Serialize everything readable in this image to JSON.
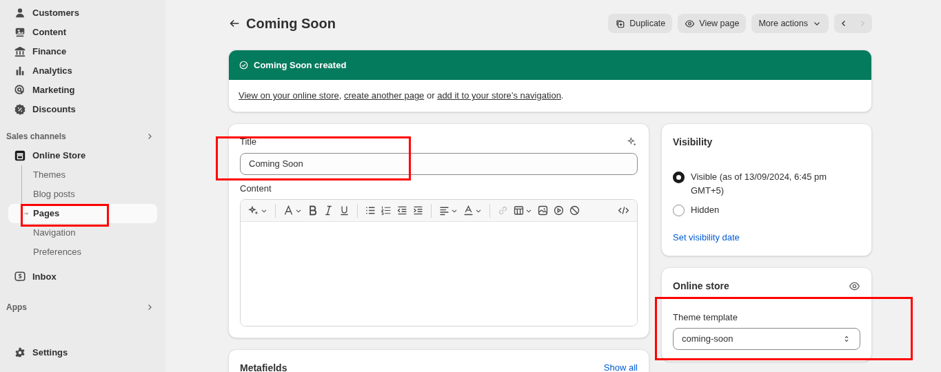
{
  "sidebar": {
    "items": [
      {
        "kind": "customers",
        "label": "Customers",
        "selected": false
      },
      {
        "kind": "content",
        "label": "Content",
        "selected": false
      },
      {
        "kind": "finance",
        "label": "Finance",
        "selected": false
      },
      {
        "kind": "analytics",
        "label": "Analytics",
        "selected": false
      },
      {
        "kind": "marketing",
        "label": "Marketing",
        "selected": false
      },
      {
        "kind": "discounts",
        "label": "Discounts",
        "selected": false
      }
    ],
    "sales_channels": {
      "title": "Sales channels",
      "items": [
        {
          "kind": "store",
          "label": "Online Store",
          "selected": false,
          "children": [
            {
              "label": "Themes",
              "selected": false,
              "highlighted": false
            },
            {
              "label": "Blog posts",
              "selected": false,
              "highlighted": false
            },
            {
              "label": "Pages",
              "selected": true,
              "highlighted": true
            },
            {
              "label": "Navigation",
              "selected": false,
              "highlighted": false
            },
            {
              "label": "Preferences",
              "selected": false,
              "highlighted": false
            }
          ]
        },
        {
          "kind": "inbox",
          "label": "Inbox",
          "selected": false
        }
      ]
    },
    "apps": {
      "title": "Apps"
    },
    "settings": {
      "kind": "settings",
      "label": "Settings",
      "selected": false
    }
  },
  "header": {
    "title": "Coming Soon",
    "actions": [
      {
        "kind": "duplicate",
        "label": "Duplicate"
      },
      {
        "kind": "view",
        "label": "View page"
      },
      {
        "kind": "more",
        "label": "More actions"
      }
    ],
    "prev_disabled": false,
    "next_disabled": true
  },
  "banner": {
    "title": "Coming Soon created",
    "links": [
      "View on your online store",
      "create another page",
      "add it to your store’s navigation"
    ],
    "texts": [
      ", ",
      " or ",
      "."
    ]
  },
  "page_card": {
    "title_label": "Title",
    "title_value": "Coming Soon",
    "title_highlighted": true,
    "content_label": "Content",
    "toolbar": [
      [
        {
          "kind": "magic",
          "dropdown": true,
          "disabled": false
        }
      ],
      [
        {
          "kind": "font",
          "dropdown": true,
          "disabled": false
        },
        {
          "kind": "bold",
          "dropdown": false,
          "disabled": false
        },
        {
          "kind": "italic",
          "dropdown": false,
          "disabled": false
        },
        {
          "kind": "underline",
          "dropdown": false,
          "disabled": false
        }
      ],
      [
        {
          "kind": "bullets",
          "dropdown": false,
          "disabled": false
        },
        {
          "kind": "numbers",
          "dropdown": false,
          "disabled": false
        },
        {
          "kind": "outdent",
          "dropdown": false,
          "disabled": false
        },
        {
          "kind": "indent",
          "dropdown": false,
          "disabled": false
        }
      ],
      [
        {
          "kind": "align",
          "dropdown": true,
          "disabled": false
        },
        {
          "kind": "color",
          "dropdown": true,
          "disabled": false
        }
      ],
      [
        {
          "kind": "link",
          "dropdown": false,
          "disabled": true
        },
        {
          "kind": "table",
          "dropdown": true,
          "disabled": false
        },
        {
          "kind": "image",
          "dropdown": false,
          "disabled": false
        },
        {
          "kind": "video",
          "dropdown": false,
          "disabled": false
        },
        {
          "kind": "clear",
          "dropdown": false,
          "disabled": false
        }
      ]
    ]
  },
  "metafields": {
    "title": "Metafields",
    "link": "Show all"
  },
  "visibility": {
    "title": "Visibility",
    "options": [
      {
        "label": "Visible (as of 13/09/2024, 6:45 pm GMT+5)",
        "selected": true
      },
      {
        "label": "Hidden",
        "selected": false
      }
    ],
    "link": "Set visibility date"
  },
  "online_store": {
    "title": "Online store",
    "template_label": "Theme template",
    "template_value": "coming-soon",
    "highlighted": true
  }
}
